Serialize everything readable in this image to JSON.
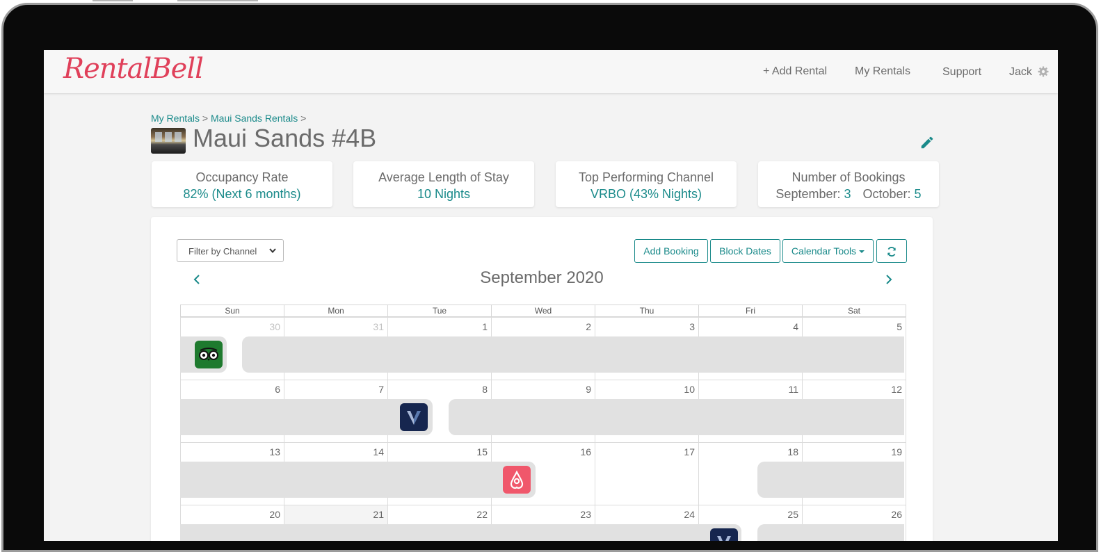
{
  "app": {
    "brand": "RentalBell"
  },
  "nav": {
    "add_rental": "+ Add Rental",
    "my_rentals": "My Rentals",
    "support": "Support",
    "user": "Jack"
  },
  "breadcrumb": {
    "item1": "My Rentals",
    "sep1": " > ",
    "item2": "Maui Sands Rentals",
    "sep2": " >"
  },
  "property": {
    "title": "Maui Sands #4B"
  },
  "stats": {
    "occupancy": {
      "label": "Occupancy Rate",
      "value": "82% (Next 6 months)"
    },
    "avg_stay": {
      "label": "Average Length of Stay",
      "value": "10 Nights"
    },
    "top_channel": {
      "label": "Top Performing Channel",
      "value": "VRBO (43% Nights)"
    },
    "bookings": {
      "label": "Number of Bookings",
      "sep_label": "September: ",
      "sep_value": "3",
      "oct_label": "October: ",
      "oct_value": "5"
    }
  },
  "toolbar": {
    "filter": "Filter by Channel",
    "add_booking": "Add Booking",
    "block_dates": "Block Dates",
    "calendar_tools": "Calendar Tools"
  },
  "calendar": {
    "month": "September 2020",
    "weekdays": [
      "Sun",
      "Mon",
      "Tue",
      "Wed",
      "Thu",
      "Fri",
      "Sat"
    ],
    "weeks": [
      [
        "30",
        "31",
        "1",
        "2",
        "3",
        "4",
        "5"
      ],
      [
        "6",
        "7",
        "8",
        "9",
        "10",
        "11",
        "12"
      ],
      [
        "13",
        "14",
        "15",
        "16",
        "17",
        "18",
        "19"
      ],
      [
        "20",
        "21",
        "22",
        "23",
        "24",
        "25",
        "26"
      ]
    ]
  },
  "channel_icons": {
    "tripadvisor": "tripadvisor-icon",
    "vrbo": "vrbo-icon",
    "airbnb": "airbnb-icon"
  },
  "colors": {
    "brand": "#e0405a",
    "accent": "#1a8a8a",
    "booking_bar": "#e1e1e1",
    "tripadvisor": "#1e7a2e",
    "vrbo": "#16264f",
    "airbnb": "#f0576b"
  }
}
